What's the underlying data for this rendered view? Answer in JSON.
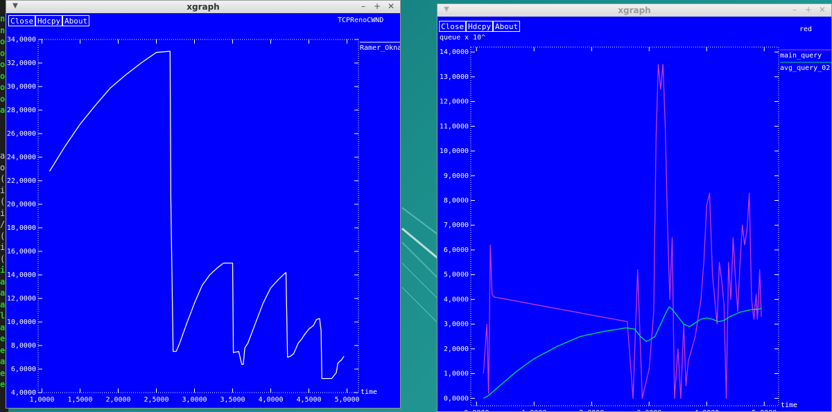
{
  "terminal_fragments": [
    "n",
    "n",
    "od",
    "od",
    "od",
    "od",
    "od",
    "od",
    "ad",
    "",
    "",
    "",
    "a",
    "or",
    "(",
    "i",
    "(",
    "i",
    "/",
    "(",
    "i",
    "(",
    "i",
    "am",
    "am",
    "am",
    "la",
    "am",
    "ed",
    "ed",
    "am",
    "ed",
    "ed"
  ],
  "window1": {
    "title": "xgraph",
    "buttons": [
      "Close",
      "Hdcpy",
      "About"
    ],
    "plot_title": "TCPRenoCWND",
    "chart_data": {
      "type": "line",
      "xlabel": "time",
      "ylabel": "",
      "xlim": [
        0.95,
        5.15
      ],
      "ylim": [
        4.0,
        34.0
      ],
      "x_ticks": [
        1.0,
        1.5,
        2.0,
        2.5,
        3.0,
        3.5,
        4.0,
        4.5,
        5.0
      ],
      "x_tick_labels": [
        "1,0000",
        "1,5000",
        "2,0000",
        "2,5000",
        "3,0000",
        "3,5000",
        "4,0000",
        "4,5000",
        "5,0000"
      ],
      "y_ticks": [
        4,
        6,
        8,
        10,
        12,
        14,
        16,
        18,
        20,
        22,
        24,
        26,
        28,
        30,
        32,
        34
      ],
      "y_tick_labels": [
        "4,0000",
        "6,0000",
        "8,0000",
        "10,0000",
        "12,0000",
        "14,0000",
        "16,0000",
        "18,0000",
        "20,0000",
        "22,0000",
        "24,0000",
        "26,0000",
        "28,0000",
        "30,0000",
        "32,0000",
        "34,0000"
      ],
      "grid": false,
      "legend_position": "top-right",
      "series": [
        {
          "name": "Ramer_Okna",
          "color": "#ffffff",
          "x": [
            1.1,
            1.3,
            1.5,
            1.7,
            1.9,
            2.1,
            2.3,
            2.5,
            2.68,
            2.69,
            2.72,
            2.76,
            2.8,
            2.9,
            3.0,
            3.1,
            3.2,
            3.3,
            3.38,
            3.42,
            3.5,
            3.51,
            3.58,
            3.62,
            3.64,
            3.66,
            3.7,
            3.8,
            3.9,
            4.0,
            4.1,
            4.18,
            4.2,
            4.22,
            4.26,
            4.3,
            4.36,
            4.4,
            4.44,
            4.5,
            4.56,
            4.6,
            4.64,
            4.66,
            4.67,
            4.7,
            4.8,
            4.86,
            4.88,
            4.93,
            4.96
          ],
          "y": [
            22.8,
            24.9,
            26.8,
            28.4,
            29.9,
            31.0,
            32.0,
            32.9,
            33.0,
            20.4,
            7.5,
            7.5,
            8.1,
            9.9,
            11.6,
            13.1,
            14.0,
            14.6,
            15.0,
            15.0,
            15.0,
            7.4,
            7.5,
            6.4,
            6.4,
            7.8,
            8.2,
            9.9,
            11.6,
            12.9,
            13.6,
            14.1,
            14.2,
            7.0,
            7.1,
            7.3,
            8.2,
            8.5,
            8.9,
            9.4,
            9.7,
            10.2,
            10.3,
            9.3,
            5.2,
            5.2,
            5.2,
            5.7,
            6.5,
            6.8,
            7.1
          ]
        }
      ]
    }
  },
  "window2": {
    "title": "xgraph",
    "buttons": [
      "Close",
      "Hdcpy",
      "About"
    ],
    "plot_title": "red",
    "chart_data": {
      "type": "line",
      "xlabel": "time",
      "ylabel": "queue x 10^",
      "xlim": [
        -0.1,
        5.25
      ],
      "ylim": [
        -0.3,
        14.2
      ],
      "x_ticks": [
        0,
        1,
        2,
        3,
        4,
        5
      ],
      "x_tick_labels": [
        "0,0000",
        "1,0000",
        "2,0000",
        "3,0000",
        "4,0000",
        "5,0000"
      ],
      "y_ticks": [
        0,
        1,
        2,
        3,
        4,
        5,
        6,
        7,
        8,
        9,
        10,
        11,
        12,
        13,
        14
      ],
      "y_tick_labels": [
        "0,0000",
        "1,0000",
        "2,0000",
        "3,0000",
        "4,0000",
        "5,0000",
        "6,0000",
        "7,0000",
        "8,0000",
        "9,0000",
        "10,0000",
        "11,0000",
        "12,0000",
        "13,0000",
        "14,0000"
      ],
      "grid": false,
      "legend_position": "top-right",
      "series": [
        {
          "name": "main_query",
          "color": "#c83cdc",
          "x": [
            0.12,
            0.18,
            0.21,
            0.24,
            0.27,
            0.3,
            2.62,
            2.72,
            2.8,
            2.88,
            3.0,
            3.08,
            3.12,
            3.16,
            3.2,
            3.24,
            3.28,
            3.32,
            3.36,
            3.4,
            3.44,
            3.5,
            3.55,
            3.6,
            3.64,
            3.68,
            3.8,
            3.9,
            3.95,
            4.0,
            4.05,
            4.1,
            4.14,
            4.18,
            4.22,
            4.26,
            4.3,
            4.34,
            4.38,
            4.42,
            4.46,
            4.5,
            4.54,
            4.58,
            4.62,
            4.66,
            4.7,
            4.74,
            4.78,
            4.82,
            4.86,
            4.88,
            4.9,
            4.92,
            4.95
          ],
          "y": [
            1.0,
            3.0,
            0.2,
            6.2,
            4.2,
            4.1,
            3.1,
            0.0,
            5.2,
            0.0,
            1.2,
            3.5,
            10.5,
            13.5,
            12.5,
            13.5,
            11.0,
            7.0,
            4.0,
            6.5,
            0.0,
            2.0,
            0.0,
            3.0,
            0.5,
            1.5,
            2.5,
            4.0,
            5.5,
            7.8,
            8.3,
            5.0,
            4.0,
            3.0,
            5.5,
            4.8,
            3.8,
            0.0,
            5.5,
            4.0,
            6.5,
            4.8,
            3.5,
            5.5,
            7.0,
            6.2,
            6.8,
            8.3,
            4.0,
            3.2,
            4.2,
            3.2,
            4.0,
            5.2,
            3.3
          ]
        },
        {
          "name": "avg_query_02",
          "color": "#00e36b",
          "x": [
            0.12,
            0.2,
            0.4,
            0.7,
            1.0,
            1.4,
            1.8,
            2.2,
            2.6,
            2.75,
            2.85,
            2.95,
            3.0,
            3.1,
            3.2,
            3.3,
            3.35,
            3.4,
            3.5,
            3.6,
            3.7,
            3.8,
            3.9,
            4.0,
            4.1,
            4.2,
            4.3,
            4.4,
            4.5,
            4.6,
            4.7,
            4.8,
            4.9,
            4.95
          ],
          "y": [
            0.0,
            0.1,
            0.5,
            1.1,
            1.6,
            2.1,
            2.5,
            2.7,
            2.85,
            2.8,
            2.5,
            2.3,
            2.35,
            2.5,
            3.0,
            3.5,
            3.7,
            3.6,
            3.3,
            3.0,
            2.9,
            3.05,
            3.2,
            3.25,
            3.2,
            3.1,
            3.15,
            3.3,
            3.4,
            3.5,
            3.55,
            3.6,
            3.6,
            3.65
          ]
        }
      ]
    }
  }
}
